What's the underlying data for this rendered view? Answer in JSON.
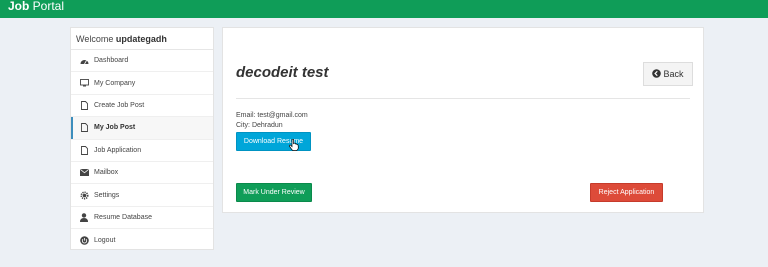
{
  "topbar": {
    "brand_bold": "Job",
    "brand_rest": " Portal"
  },
  "sidebar": {
    "welcome_prefix": "Welcome ",
    "username": "updategadh",
    "items": [
      {
        "label": "Dashboard",
        "icon": "dashboard-icon",
        "active": false
      },
      {
        "label": "My Company",
        "icon": "monitor-icon",
        "active": false
      },
      {
        "label": "Create Job Post",
        "icon": "file-icon",
        "active": false
      },
      {
        "label": "My Job Post",
        "icon": "file-icon",
        "active": true
      },
      {
        "label": "Job Application",
        "icon": "file-icon",
        "active": false
      },
      {
        "label": "Mailbox",
        "icon": "envelope-icon",
        "active": false
      },
      {
        "label": "Settings",
        "icon": "gear-icon",
        "active": false
      },
      {
        "label": "Resume Database",
        "icon": "user-icon",
        "active": false
      },
      {
        "label": "Logout",
        "icon": "power-icon",
        "active": false
      }
    ]
  },
  "main": {
    "title": "decodeit test",
    "back_label": "Back",
    "email": "Email: test@gmail.com",
    "city": "City: Dehradun",
    "download_label": "Download Resume",
    "review_label": "Mark Under Review",
    "reject_label": "Reject Application"
  },
  "colors": {
    "brand_green": "#0f9d58",
    "info_blue": "#00a6d9",
    "danger_red": "#dd4b39",
    "active_marker": "#3c8dbc"
  }
}
